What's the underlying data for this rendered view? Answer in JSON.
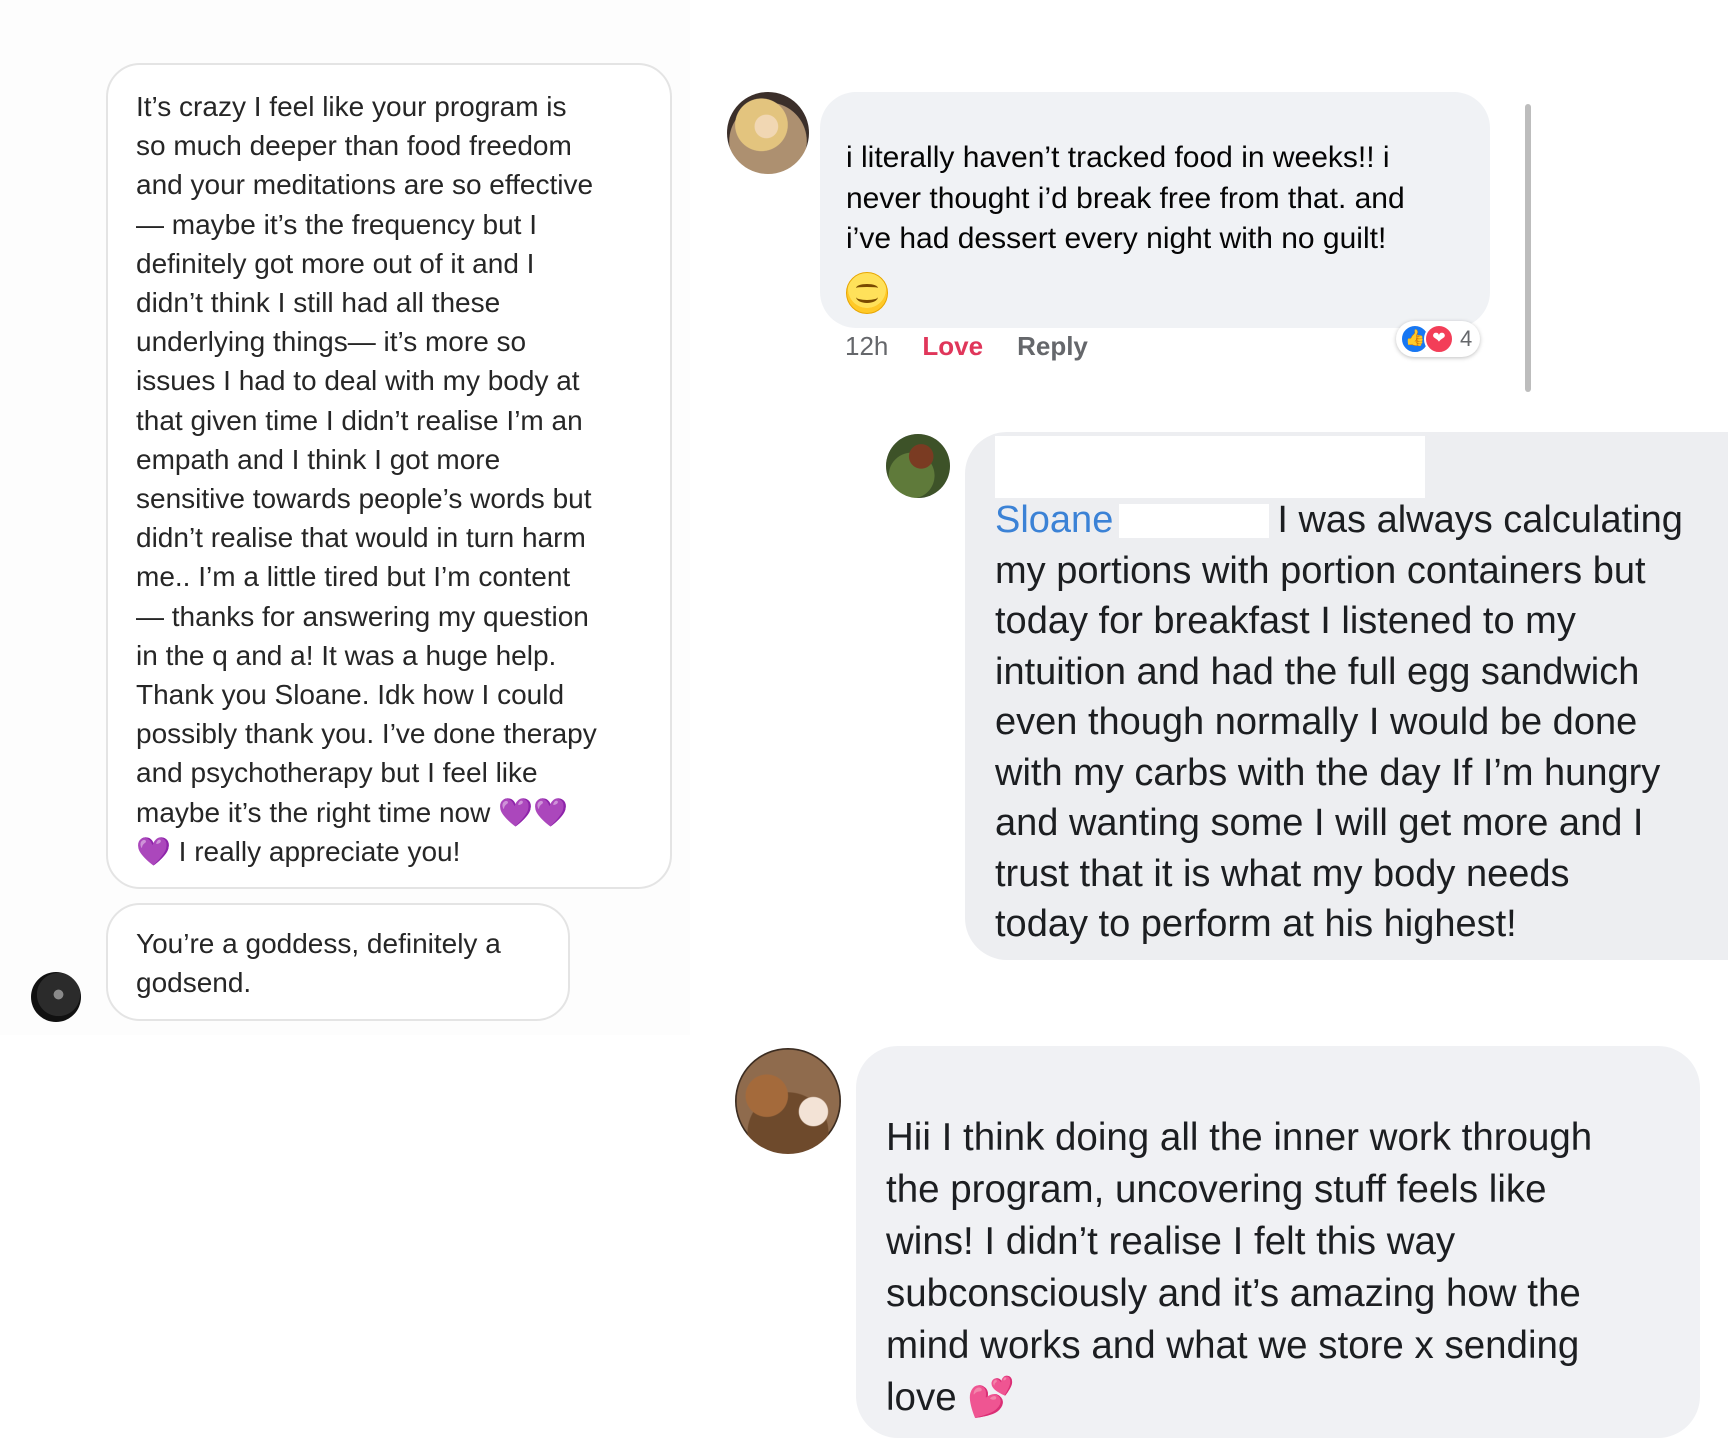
{
  "dm": {
    "message_long": "It’s crazy I feel like your program is\nso much deeper than food freedom\nand your meditations are so effective\n— maybe it’s the frequency but I\ndefinitely got more out of it and I\ndidn’t think I still had all these\nunderlying things— it’s more so\nissues I had to deal with my body at\nthat given time I didn’t realise I’m an\nempath and I think I got more\nsensitive towards people’s words but\ndidn’t realise that would in turn harm\nme.. I’m a little tired but I’m content\n— thanks for answering my question\nin the q and a! It was a huge help.\nThank you Sloane. Idk how I could\npossibly thank you. I’ve done therapy\nand psychotherapy but I feel like",
    "message_long_last_line": "maybe it’s the right time now",
    "hearts": "💜💜",
    "message_long_tail_heart": "💜",
    "message_long_tail": "I really appreciate you!",
    "message_short": "You’re a goddess, definitely a\ngodsend."
  },
  "comment1": {
    "text": "i literally haven’t tracked food in weeks!! i\nnever thought i’d break free from that. and\ni’ve had dessert every night with no guilt!",
    "time": "12h",
    "love_label": "Love",
    "reply_label": "Reply",
    "reaction_count": "4",
    "like_icon": "👍",
    "love_icon": "❤"
  },
  "comment2": {
    "tag_name": "Sloane",
    "lines": [
      "I was always calculating",
      "my portions with portion containers but",
      "today for breakfast I listened to my",
      "intuition and had the full egg sandwich",
      "even though normally I would be done",
      "with my carbs with the day If I’m hungry",
      "and wanting some I will get more and I",
      "trust that it is what my body needs",
      "today to perform at his highest!"
    ]
  },
  "comment3": {
    "text": "Hii I think doing all the inner work through\nthe program, uncovering stuff feels like\nwins! I didn’t realise I felt this way\nsubconsciously and it’s amazing how the\nmind works and what we store x sending\nlove 💕"
  },
  "colors": {
    "love_red": "#e0365a",
    "tag_blue": "#3b82d6",
    "bubble_grey": "#f0f2f5",
    "like_blue": "#1877f2"
  }
}
